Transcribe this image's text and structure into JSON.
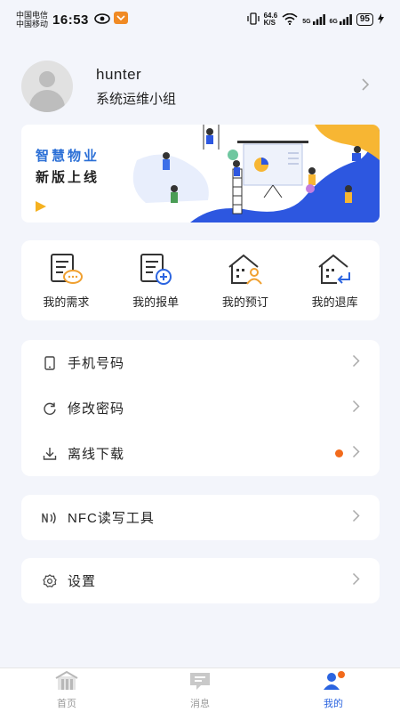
{
  "status_bar": {
    "carrier_1": "中国电信",
    "carrier_2": "中国移动",
    "time": "16:53",
    "net_speed_value": "64.6",
    "net_speed_unit": "K/S",
    "signal_1": "5G",
    "signal_2": "6G",
    "battery": "95"
  },
  "profile": {
    "name": "hunter",
    "group": "系统运维小组"
  },
  "banner": {
    "title_line1": "智慧物业",
    "title_line2": "新版上线"
  },
  "quick_actions": [
    {
      "label": "我的需求",
      "icon": "document-chat-icon"
    },
    {
      "label": "我的报单",
      "icon": "document-add-icon"
    },
    {
      "label": "我的预订",
      "icon": "building-person-icon"
    },
    {
      "label": "我的退库",
      "icon": "building-return-icon"
    }
  ],
  "menu_account": [
    {
      "label": "手机号码",
      "icon": "phone-icon"
    },
    {
      "label": "修改密码",
      "icon": "refresh-icon"
    },
    {
      "label": "离线下载",
      "icon": "download-icon",
      "badge_dot": true
    }
  ],
  "menu_tools": [
    {
      "label": "NFC读写工具",
      "icon": "nfc-icon"
    }
  ],
  "menu_settings": [
    {
      "label": "设置",
      "icon": "settings-icon"
    }
  ],
  "bottom_nav": [
    {
      "label": "首页",
      "icon": "home-icon"
    },
    {
      "label": "消息",
      "icon": "message-icon"
    },
    {
      "label": "我的",
      "icon": "user-icon",
      "active": true
    }
  ],
  "colors": {
    "accent": "#2b64e0",
    "badge": "#f26a1b",
    "banner_yellow": "#f5b11f",
    "background": "#f3f5fb"
  }
}
